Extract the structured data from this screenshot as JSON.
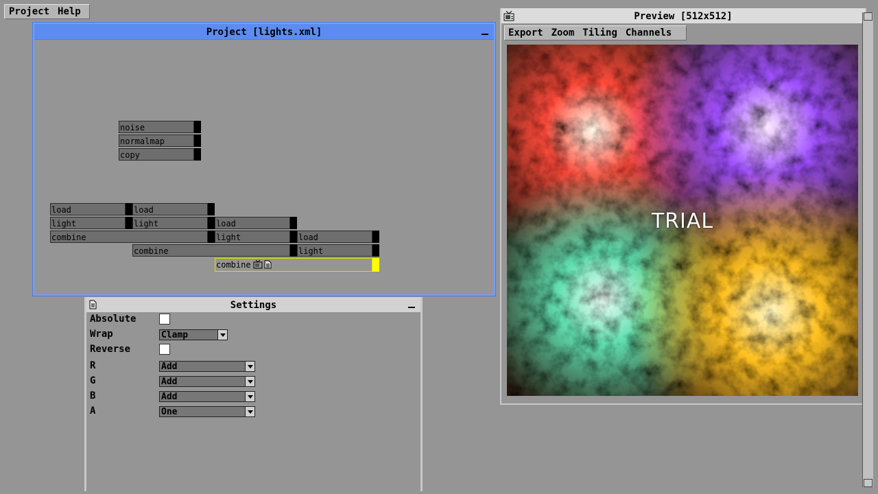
{
  "menubar": {
    "project": "Project",
    "help": "Help"
  },
  "project_window": {
    "title": "Project [lights.xml]",
    "nodes": [
      {
        "label": "noise"
      },
      {
        "label": "normalmap"
      },
      {
        "label": "copy"
      },
      {
        "label": "load"
      },
      {
        "label": "load"
      },
      {
        "label": "light"
      },
      {
        "label": "light"
      },
      {
        "label": "load"
      },
      {
        "label": "combine"
      },
      {
        "label": "light"
      },
      {
        "label": "load"
      },
      {
        "label": "combine"
      },
      {
        "label": "light"
      },
      {
        "label": "combine"
      }
    ]
  },
  "settings_window": {
    "title": "Settings",
    "rows": [
      {
        "label": "Absolute",
        "checked": false
      },
      {
        "label": "Wrap",
        "value": "Clamp"
      },
      {
        "label": "Reverse",
        "checked": false
      },
      {
        "label": "R",
        "value": "Add"
      },
      {
        "label": "G",
        "value": "Add"
      },
      {
        "label": "B",
        "value": "Add"
      },
      {
        "label": "A",
        "value": "One"
      }
    ]
  },
  "preview_window": {
    "title": "Preview [512x512]",
    "menu": {
      "export": "Export",
      "zoom": "Zoom",
      "tiling": "Tiling",
      "channels": "Channels"
    },
    "overlay_text": "TRIAL",
    "lights": [
      {
        "color": "#ff4a3a"
      },
      {
        "color": "#a050ff"
      },
      {
        "color": "#60e0b0"
      },
      {
        "color": "#ffc020"
      }
    ]
  }
}
